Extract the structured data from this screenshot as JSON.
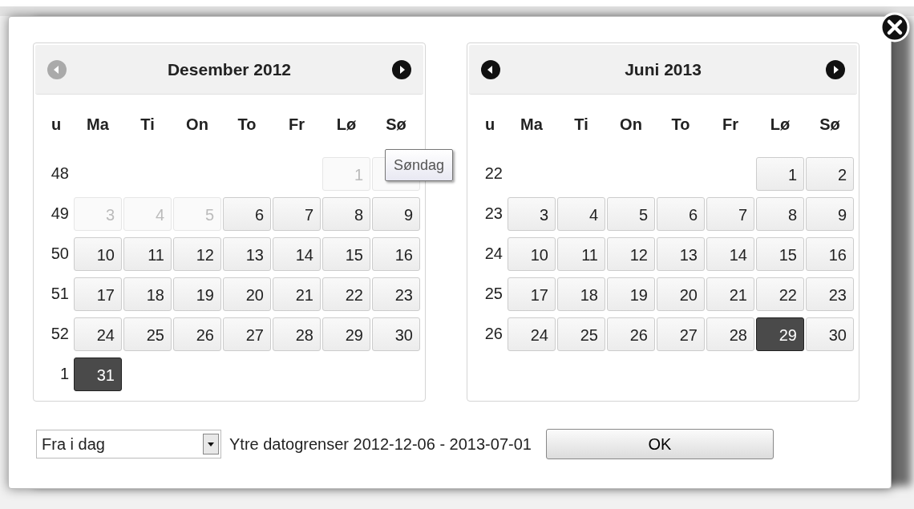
{
  "calendars": [
    {
      "title": "Desember 2012",
      "prev": {
        "disabled": true
      },
      "next": {
        "disabled": false
      },
      "week_label": "u",
      "weekdays": [
        "Ma",
        "Ti",
        "On",
        "To",
        "Fr",
        "Lø",
        "Sø"
      ],
      "weeks": [
        {
          "number": "48",
          "days": [
            {
              "kind": "blank"
            },
            {
              "kind": "blank"
            },
            {
              "kind": "blank"
            },
            {
              "kind": "blank"
            },
            {
              "kind": "blank"
            },
            {
              "kind": "day",
              "text": "1",
              "disabled": true,
              "selected": false
            },
            {
              "kind": "covered",
              "disabled": true,
              "selected": false
            }
          ]
        },
        {
          "number": "49",
          "days": [
            {
              "kind": "day",
              "text": "3",
              "disabled": true,
              "selected": false
            },
            {
              "kind": "day",
              "text": "4",
              "disabled": true,
              "selected": false
            },
            {
              "kind": "day",
              "text": "5",
              "disabled": true,
              "selected": false
            },
            {
              "kind": "day",
              "text": "6",
              "disabled": false,
              "selected": false
            },
            {
              "kind": "day",
              "text": "7",
              "disabled": false,
              "selected": false
            },
            {
              "kind": "day",
              "text": "8",
              "disabled": false,
              "selected": false
            },
            {
              "kind": "day",
              "text": "9",
              "disabled": false,
              "selected": false
            }
          ]
        },
        {
          "number": "50",
          "days": [
            {
              "kind": "day",
              "text": "10",
              "disabled": false,
              "selected": false
            },
            {
              "kind": "day",
              "text": "11",
              "disabled": false,
              "selected": false
            },
            {
              "kind": "day",
              "text": "12",
              "disabled": false,
              "selected": false
            },
            {
              "kind": "day",
              "text": "13",
              "disabled": false,
              "selected": false
            },
            {
              "kind": "day",
              "text": "14",
              "disabled": false,
              "selected": false
            },
            {
              "kind": "day",
              "text": "15",
              "disabled": false,
              "selected": false
            },
            {
              "kind": "day",
              "text": "16",
              "disabled": false,
              "selected": false
            }
          ]
        },
        {
          "number": "51",
          "days": [
            {
              "kind": "day",
              "text": "17",
              "disabled": false,
              "selected": false
            },
            {
              "kind": "day",
              "text": "18",
              "disabled": false,
              "selected": false
            },
            {
              "kind": "day",
              "text": "19",
              "disabled": false,
              "selected": false
            },
            {
              "kind": "day",
              "text": "20",
              "disabled": false,
              "selected": false
            },
            {
              "kind": "day",
              "text": "21",
              "disabled": false,
              "selected": false
            },
            {
              "kind": "day",
              "text": "22",
              "disabled": false,
              "selected": false
            },
            {
              "kind": "day",
              "text": "23",
              "disabled": false,
              "selected": false
            }
          ]
        },
        {
          "number": "52",
          "days": [
            {
              "kind": "day",
              "text": "24",
              "disabled": false,
              "selected": false
            },
            {
              "kind": "day",
              "text": "25",
              "disabled": false,
              "selected": false
            },
            {
              "kind": "day",
              "text": "26",
              "disabled": false,
              "selected": false
            },
            {
              "kind": "day",
              "text": "27",
              "disabled": false,
              "selected": false
            },
            {
              "kind": "day",
              "text": "28",
              "disabled": false,
              "selected": false
            },
            {
              "kind": "day",
              "text": "29",
              "disabled": false,
              "selected": false
            },
            {
              "kind": "day",
              "text": "30",
              "disabled": false,
              "selected": false
            }
          ]
        },
        {
          "number": "1",
          "days": [
            {
              "kind": "day",
              "text": "31",
              "disabled": false,
              "selected": true
            }
          ]
        }
      ]
    },
    {
      "title": "Juni 2013",
      "prev": {
        "disabled": false
      },
      "next": {
        "disabled": false
      },
      "week_label": "u",
      "weekdays": [
        "Ma",
        "Ti",
        "On",
        "To",
        "Fr",
        "Lø",
        "Sø"
      ],
      "weeks": [
        {
          "number": "22",
          "days": [
            {
              "kind": "blank"
            },
            {
              "kind": "blank"
            },
            {
              "kind": "blank"
            },
            {
              "kind": "blank"
            },
            {
              "kind": "blank"
            },
            {
              "kind": "day",
              "text": "1",
              "disabled": false,
              "selected": false
            },
            {
              "kind": "day",
              "text": "2",
              "disabled": false,
              "selected": false
            }
          ]
        },
        {
          "number": "23",
          "days": [
            {
              "kind": "day",
              "text": "3",
              "disabled": false,
              "selected": false
            },
            {
              "kind": "day",
              "text": "4",
              "disabled": false,
              "selected": false
            },
            {
              "kind": "day",
              "text": "5",
              "disabled": false,
              "selected": false
            },
            {
              "kind": "day",
              "text": "6",
              "disabled": false,
              "selected": false
            },
            {
              "kind": "day",
              "text": "7",
              "disabled": false,
              "selected": false
            },
            {
              "kind": "day",
              "text": "8",
              "disabled": false,
              "selected": false
            },
            {
              "kind": "day",
              "text": "9",
              "disabled": false,
              "selected": false
            }
          ]
        },
        {
          "number": "24",
          "days": [
            {
              "kind": "day",
              "text": "10",
              "disabled": false,
              "selected": false
            },
            {
              "kind": "day",
              "text": "11",
              "disabled": false,
              "selected": false
            },
            {
              "kind": "day",
              "text": "12",
              "disabled": false,
              "selected": false
            },
            {
              "kind": "day",
              "text": "13",
              "disabled": false,
              "selected": false
            },
            {
              "kind": "day",
              "text": "14",
              "disabled": false,
              "selected": false
            },
            {
              "kind": "day",
              "text": "15",
              "disabled": false,
              "selected": false
            },
            {
              "kind": "day",
              "text": "16",
              "disabled": false,
              "selected": false
            }
          ]
        },
        {
          "number": "25",
          "days": [
            {
              "kind": "day",
              "text": "17",
              "disabled": false,
              "selected": false
            },
            {
              "kind": "day",
              "text": "18",
              "disabled": false,
              "selected": false
            },
            {
              "kind": "day",
              "text": "19",
              "disabled": false,
              "selected": false
            },
            {
              "kind": "day",
              "text": "20",
              "disabled": false,
              "selected": false
            },
            {
              "kind": "day",
              "text": "21",
              "disabled": false,
              "selected": false
            },
            {
              "kind": "day",
              "text": "22",
              "disabled": false,
              "selected": false
            },
            {
              "kind": "day",
              "text": "23",
              "disabled": false,
              "selected": false
            }
          ]
        },
        {
          "number": "26",
          "days": [
            {
              "kind": "day",
              "text": "24",
              "disabled": false,
              "selected": false
            },
            {
              "kind": "day",
              "text": "25",
              "disabled": false,
              "selected": false
            },
            {
              "kind": "day",
              "text": "26",
              "disabled": false,
              "selected": false
            },
            {
              "kind": "day",
              "text": "27",
              "disabled": false,
              "selected": false
            },
            {
              "kind": "day",
              "text": "28",
              "disabled": false,
              "selected": false
            },
            {
              "kind": "day",
              "text": "29",
              "disabled": false,
              "selected": true
            },
            {
              "kind": "day",
              "text": "30",
              "disabled": false,
              "selected": false
            }
          ]
        }
      ]
    }
  ],
  "tooltip": {
    "text": "Søndag"
  },
  "range_select": {
    "value": "Fra i dag"
  },
  "limits_text": "Ytre datogrenser 2012-12-06 - 2013-07-01",
  "ok_button": "OK"
}
